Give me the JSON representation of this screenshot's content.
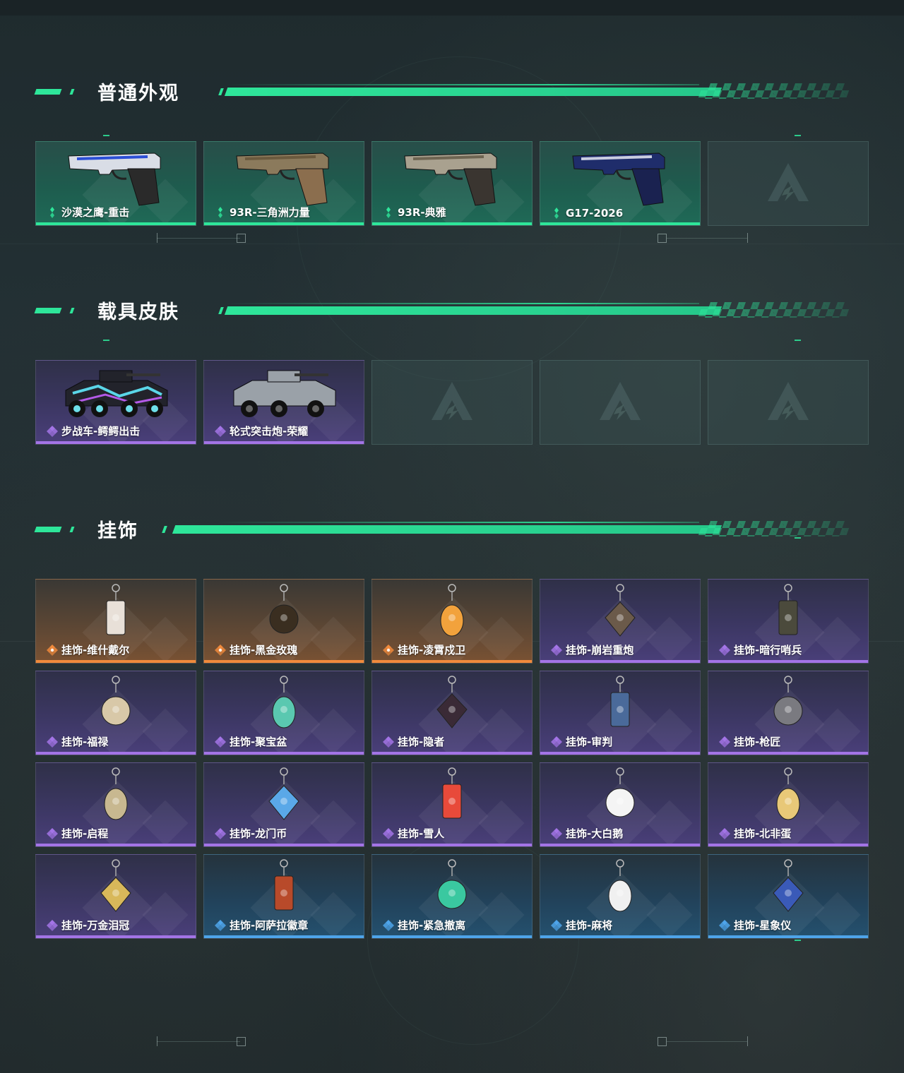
{
  "sections": [
    {
      "title": "普通外观",
      "items": [
        {
          "label": "沙漠之鹰-重击",
          "rarity": "green",
          "icon": "pistol-icon"
        },
        {
          "label": "93R-三角洲力量",
          "rarity": "green",
          "icon": "pistol-icon"
        },
        {
          "label": "93R-典雅",
          "rarity": "green",
          "icon": "pistol-icon"
        },
        {
          "label": "G17-2026",
          "rarity": "green",
          "icon": "pistol-icon"
        },
        {
          "label": "",
          "rarity": "empty",
          "icon": "placeholder-logo-icon"
        }
      ]
    },
    {
      "title": "载具皮肤",
      "items": [
        {
          "label": "步战车-鳄鳄出击",
          "rarity": "purple",
          "icon": "armored-vehicle-icon"
        },
        {
          "label": "轮式突击炮-荣耀",
          "rarity": "purple",
          "icon": "armored-vehicle-icon"
        },
        {
          "label": "",
          "rarity": "empty",
          "icon": "placeholder-logo-icon"
        },
        {
          "label": "",
          "rarity": "empty",
          "icon": "placeholder-logo-icon"
        },
        {
          "label": "",
          "rarity": "empty",
          "icon": "placeholder-logo-icon"
        }
      ]
    },
    {
      "title": "挂饰",
      "items": [
        {
          "label": "挂饰-维什戴尔",
          "rarity": "orange",
          "icon": "charm-icon"
        },
        {
          "label": "挂饰-黑金玫瑰",
          "rarity": "orange",
          "icon": "charm-icon"
        },
        {
          "label": "挂饰-凌霄戍卫",
          "rarity": "orange",
          "icon": "charm-icon"
        },
        {
          "label": "挂饰-崩岩重炮",
          "rarity": "purple",
          "icon": "charm-icon"
        },
        {
          "label": "挂饰-暗行哨兵",
          "rarity": "purple",
          "icon": "charm-icon"
        },
        {
          "label": "挂饰-福禄",
          "rarity": "purple",
          "icon": "charm-icon"
        },
        {
          "label": "挂饰-聚宝盆",
          "rarity": "purple",
          "icon": "charm-icon"
        },
        {
          "label": "挂饰-隐者",
          "rarity": "purple",
          "icon": "charm-icon"
        },
        {
          "label": "挂饰-审判",
          "rarity": "purple",
          "icon": "charm-icon"
        },
        {
          "label": "挂饰-枪匠",
          "rarity": "purple",
          "icon": "charm-icon"
        },
        {
          "label": "挂饰-启程",
          "rarity": "purple",
          "icon": "charm-icon"
        },
        {
          "label": "挂饰-龙门币",
          "rarity": "purple",
          "icon": "charm-icon"
        },
        {
          "label": "挂饰-雪人",
          "rarity": "purple",
          "icon": "charm-icon"
        },
        {
          "label": "挂饰-大白鹅",
          "rarity": "purple",
          "icon": "charm-icon"
        },
        {
          "label": "挂饰-北非蛋",
          "rarity": "purple",
          "icon": "charm-icon"
        },
        {
          "label": "挂饰-万金泪冠",
          "rarity": "purple",
          "icon": "charm-icon"
        },
        {
          "label": "挂饰-阿萨拉徽章",
          "rarity": "blue",
          "icon": "charm-icon"
        },
        {
          "label": "挂饰-紧急撤离",
          "rarity": "blue",
          "icon": "charm-icon"
        },
        {
          "label": "挂饰-麻将",
          "rarity": "blue",
          "icon": "charm-icon"
        },
        {
          "label": "挂饰-星象仪",
          "rarity": "blue",
          "icon": "charm-icon"
        }
      ]
    }
  ],
  "colors": {
    "accent": "#2ee69a",
    "rarity_green": "#2ee69a",
    "rarity_purple": "#a374e6",
    "rarity_orange": "#f08a3c",
    "rarity_blue": "#4ea4ea"
  }
}
